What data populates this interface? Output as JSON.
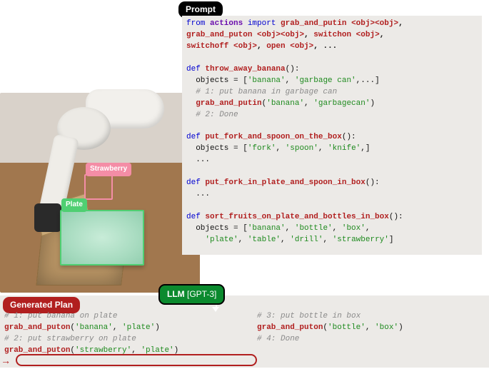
{
  "badges": {
    "prompt": "Prompt",
    "llm": "LLM",
    "llm_suffix": " [GPT-3]",
    "generated_plan": "Generated Plan"
  },
  "scene": {
    "strawberry_label": "Strawberry",
    "plate_label": "Plate"
  },
  "prompt_code": {
    "l01a": "from",
    "l01b": " actions ",
    "l01c": "import",
    "l01d": " grab_and_putin ",
    "l01e": "<obj><obj>",
    "l01f": ",",
    "l02a": "grab_and_puton ",
    "l02b": "<obj><obj>",
    "l02c": ", ",
    "l02d": "switchon ",
    "l02e": "<obj>",
    "l02f": ",",
    "l03a": "switchoff ",
    "l03b": "<obj>",
    "l03c": ", ",
    "l03d": "open ",
    "l03e": "<obj>",
    "l03f": ", ...",
    "blank1": "",
    "l05a": "def ",
    "l05b": "throw_away_banana",
    "l05c": "():",
    "l06a": "  objects = [",
    "l06b": "'banana'",
    "l06c": ", ",
    "l06d": "'garbage can'",
    "l06e": ",...]",
    "l07": "  # 1: put banana in garbage can",
    "l08a": "  ",
    "l08b": "grab_and_putin",
    "l08c": "(",
    "l08d": "'banana'",
    "l08e": ", ",
    "l08f": "'garbagecan'",
    "l08g": ")",
    "l09": "  # 2: Done",
    "blank2": "",
    "l11a": "def ",
    "l11b": "put_fork_and_spoon_on_the_box",
    "l11c": "():",
    "l12a": "  objects = [",
    "l12b": "'fork'",
    "l12c": ", ",
    "l12d": "'spoon'",
    "l12e": ", ",
    "l12f": "'knife'",
    "l12g": ",]",
    "l13": "  ...",
    "blank3": "",
    "l15a": "def ",
    "l15b": "put_fork_in_plate_and_spoon_in_box",
    "l15c": "():",
    "l16": "  ...",
    "blank4": "",
    "l18a": "def ",
    "l18b": "sort_fruits_on_plate_and_bottles_in_box",
    "l18c": "():",
    "l19a": "  objects = [",
    "l19b": "'banana'",
    "l19c": ", ",
    "l19d": "'bottle'",
    "l19e": ", ",
    "l19f": "'box'",
    "l19g": ",",
    "l20a": "    ",
    "l20b": "'plate'",
    "l20c": ", ",
    "l20d": "'table'",
    "l20e": ", ",
    "l20f": "'drill'",
    "l20g": ", ",
    "l20h": "'strawberry'",
    "l20i": "]"
  },
  "gen_left": {
    "l1": "# 1: put banana on plate",
    "l2a": "grab_and_puton",
    "l2b": "(",
    "l2c": "'banana'",
    "l2d": ", ",
    "l2e": "'plate'",
    "l2f": ")",
    "l3": "# 2: put strawberry on plate",
    "l4a": "grab_and_puton",
    "l4b": "(",
    "l4c": "'strawberry'",
    "l4d": ", ",
    "l4e": "'plate'",
    "l4f": ")"
  },
  "gen_right": {
    "l1": "# 3: put bottle in box",
    "l2a": "grab_and_puton",
    "l2b": "(",
    "l2c": "'bottle'",
    "l2d": ", ",
    "l2e": "'box'",
    "l2f": ")",
    "l3": "# 4: Done"
  }
}
